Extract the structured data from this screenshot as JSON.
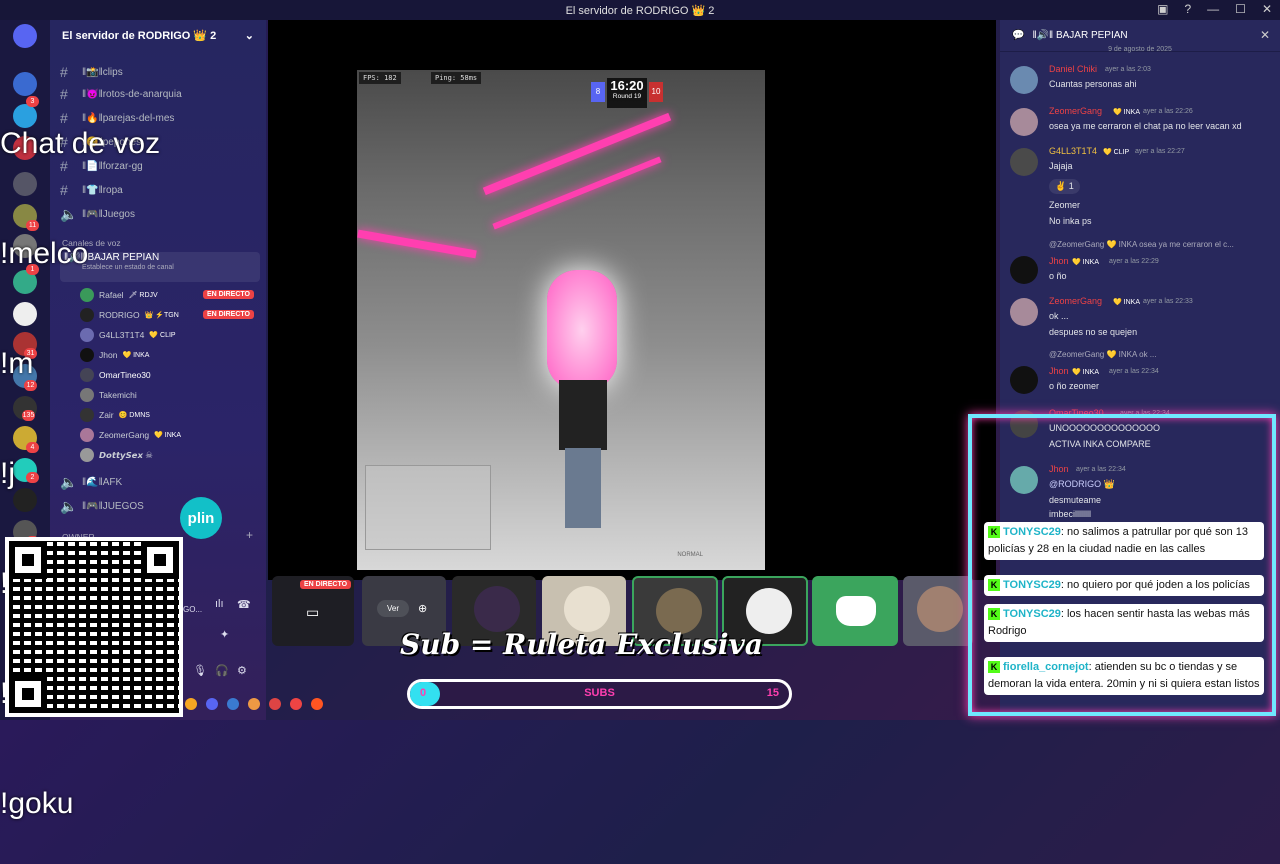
{
  "window": {
    "title": "El servidor de RODRIGO 👑 2"
  },
  "sidebar": {
    "server_name": "El servidor de RODRIGO 👑 2",
    "channels": [
      {
        "name": "‖📸‖clips"
      },
      {
        "name": "‖😈‖rotos-de-anarquia"
      },
      {
        "name": "‖🔥‖parejas-del-mes"
      },
      {
        "name": "‖😊‖pepones"
      },
      {
        "name": "‖📄‖forzar-gg"
      },
      {
        "name": "‖👕‖ropa"
      },
      {
        "name": "‖🎮‖Juegos"
      }
    ],
    "voice_category": "Canales de voz",
    "active_voice": {
      "name": "‖🔊‖ BAJAR PEPIAN",
      "status": "Establece un estado de canal"
    },
    "voice_users": [
      {
        "name": "Rafael",
        "tag": "🗡 RDJV",
        "live": "EN DIRECTO"
      },
      {
        "name": "RODRIGO",
        "tag": "👑 ⚡TGN",
        "live": "EN DIRECTO"
      },
      {
        "name": "G4LL3T1T4",
        "tag": "💛 CLIP",
        "live": ""
      },
      {
        "name": "Jhon",
        "tag": "💛 INKA",
        "live": ""
      },
      {
        "name": "OmarTineo30",
        "tag": "",
        "live": ""
      },
      {
        "name": "Takemichi",
        "tag": "",
        "live": ""
      },
      {
        "name": "Zair",
        "tag": "😊 DMNS",
        "live": ""
      },
      {
        "name": "ZeomerGang",
        "tag": "💛 INKA",
        "live": ""
      },
      {
        "name": "𝘿𝙤𝙩𝙩𝙮𝙎𝙚𝙭 ☠",
        "tag": "",
        "live": ""
      }
    ],
    "other_voice": [
      {
        "name": "‖🌊‖AFK"
      },
      {
        "name": "‖🎮‖JUEGOS"
      }
    ],
    "owner_label": "OWNER",
    "user_panel_name": "GO..."
  },
  "overlay": {
    "commands": [
      "Chat de voz",
      "!melco",
      "!m",
      "!j",
      "!s",
      "!t",
      "!goku"
    ],
    "plin_label": "plin",
    "sub_banner": "Sub = Ruleta Exclusiva",
    "subs": {
      "label": "SUBS",
      "min": "0",
      "max": "15",
      "progress": 0.05
    }
  },
  "game": {
    "fps": "FPS: 182",
    "ping": "Ping: 58ms",
    "timer": "16:20",
    "round": "Round 19",
    "team_left": "8",
    "team_right": "10",
    "hud_mode": "NORMAL"
  },
  "filmstrip": {
    "live_label": "EN DIRECTO",
    "ver_label": "Ver"
  },
  "chat": {
    "channel": "‖🔊‖ BAJAR PEPIAN",
    "date_divider": "9 de agosto de 2025",
    "messages": [
      {
        "author": "Daniel Chiki",
        "tag": "",
        "time": "ayer a las 2:03",
        "lines": [
          "Cuantas personas ahi"
        ]
      },
      {
        "author": "ZeomerGang",
        "tag": "💛 INKA",
        "time": "ayer a las 22:26",
        "lines": [
          "osea ya me cerraron el chat pa no leer vacan xd"
        ]
      },
      {
        "author": "G4LL3T1T4",
        "tag": "💛 CLIP",
        "time": "ayer a las 22:27",
        "lines": [
          "Jajaja",
          "1",
          "Zeomer",
          "No inka ps"
        ]
      },
      {
        "author": "Jhon",
        "tag": "💛 INKA",
        "time": "ayer a las 22:29",
        "reply": "@ZeomerGang 💛 INKA osea ya me cerraron el c...",
        "lines": [
          "o ño"
        ]
      },
      {
        "author": "ZeomerGang",
        "tag": "💛 INKA",
        "time": "ayer a las 22:33",
        "lines": [
          "ok ...",
          "despues no se quejen"
        ]
      },
      {
        "author": "Jhon",
        "tag": "💛 INKA",
        "time": "ayer a las 22:34",
        "reply": "@ZeomerGang 💛 INKA ok ...",
        "lines": [
          "o ño zeomer"
        ]
      },
      {
        "author": "OmarTineo30",
        "tag": "",
        "time": "ayer a las 22:34",
        "lines": [
          "UNOOOOOOOOOOOOOO",
          "ACTIVA INKA COMPARE"
        ]
      },
      {
        "author": "Jhon",
        "tag": "",
        "time": "ayer a las 22:34",
        "lines": [
          "@RODRIGO 👑",
          "desmuteame",
          "imbecillllllll"
        ]
      }
    ]
  },
  "twitch_chat": [
    {
      "user": "TONYSC29",
      "text": ": no salimos a patrullar por qué son 13 policías y 28 en la ciudad nadie en las calles"
    },
    {
      "user": "TONYSC29",
      "text": ": no quiero por qué joden a los policías"
    },
    {
      "user": "TONYSC29",
      "text": ": los hacen sentir hasta las webas más Rodrigo"
    },
    {
      "user": "fiorella_cornejot",
      "text": ": atienden su bc o tiendas y se demoran la vida entera. 20min y ni si quiera estan listos"
    }
  ]
}
